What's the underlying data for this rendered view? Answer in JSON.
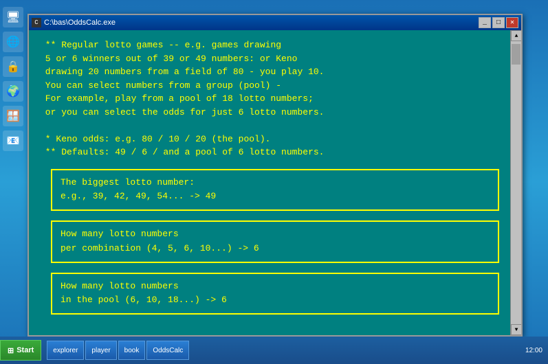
{
  "desktop": {
    "color": "#1a8fd1"
  },
  "window": {
    "title": "C:\\bas\\OddsCalc.exe",
    "title_bar_buttons": {
      "minimize": "_",
      "maximize": "□",
      "close": "✕"
    }
  },
  "console": {
    "lines": [
      " ** Regular lotto games -- e.g. games drawing",
      " 5 or 6 winners out of 39 or 49 numbers: or Keno",
      " drawing 20 numbers from a field of 80 - you play 10.",
      " You can select numbers from a group (pool) -",
      " For example, play from a pool of 18 lotto numbers;",
      " or you can select the odds for just 6 lotto numbers.",
      "",
      " * Keno odds: e.g. 80 / 10 / 20 (the pool).",
      " ** Defaults: 49 / 6 / and a pool of 6 lotto numbers."
    ]
  },
  "input_boxes": [
    {
      "line1": "The biggest lotto number:",
      "line2": "e.g., 39, 42, 49, 54... -> 49"
    },
    {
      "line1": "How many lotto numbers",
      "line2": "per combination (4, 5, 6, 10...) -> 6"
    },
    {
      "line1": "How many lotto numbers",
      "line2": "in the pool (6, 10, 18...) -> 6"
    }
  ],
  "sidebar": {
    "icons": [
      "🖥",
      "🌐",
      "🔒",
      "🌐",
      "🪟",
      "📧"
    ]
  },
  "taskbar": {
    "start_label": "Start",
    "items": [
      "explorer",
      "player",
      "book",
      "OddsCalc"
    ],
    "time": "12:00"
  }
}
